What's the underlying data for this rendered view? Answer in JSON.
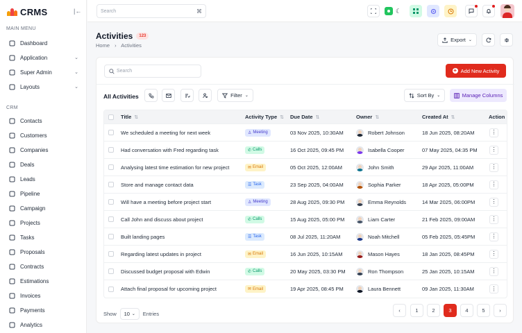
{
  "app": {
    "name": "CRMS"
  },
  "sidebar": {
    "section_main": "MAIN MENU",
    "section_crm": "CRM",
    "main_items": [
      {
        "label": "Dashboard",
        "icon": "dashboard-icon",
        "has_chevron": false
      },
      {
        "label": "Application",
        "icon": "application-icon",
        "has_chevron": true
      },
      {
        "label": "Super Admin",
        "icon": "user-shield-icon",
        "has_chevron": true
      },
      {
        "label": "Layouts",
        "icon": "layout-icon",
        "has_chevron": true
      }
    ],
    "crm_items": [
      {
        "label": "Contacts",
        "icon": "contacts-icon"
      },
      {
        "label": "Customers",
        "icon": "customers-icon"
      },
      {
        "label": "Companies",
        "icon": "building-icon"
      },
      {
        "label": "Deals",
        "icon": "deals-icon"
      },
      {
        "label": "Leads",
        "icon": "leads-icon"
      },
      {
        "label": "Pipeline",
        "icon": "pipeline-icon"
      },
      {
        "label": "Campaign",
        "icon": "campaign-icon"
      },
      {
        "label": "Projects",
        "icon": "projects-icon"
      },
      {
        "label": "Tasks",
        "icon": "tasks-icon"
      },
      {
        "label": "Proposals",
        "icon": "proposals-icon"
      },
      {
        "label": "Contracts",
        "icon": "contracts-icon"
      },
      {
        "label": "Estimations",
        "icon": "estimations-icon"
      },
      {
        "label": "Invoices",
        "icon": "invoices-icon"
      },
      {
        "label": "Payments",
        "icon": "payments-icon"
      },
      {
        "label": "Analytics",
        "icon": "analytics-icon"
      }
    ]
  },
  "topbar": {
    "search_placeholder": "Search",
    "shortcut": "⌘"
  },
  "page": {
    "title": "Activities",
    "count": "123",
    "breadcrumb_home": "Home",
    "breadcrumb_current": "Activities",
    "export_label": "Export"
  },
  "card": {
    "search_placeholder": "Search",
    "add_button": "Add New Activity",
    "all_label": "All Activities",
    "filter_label": "Filter",
    "sort_label": "Sort By",
    "manage_columns": "Manage Columns"
  },
  "table": {
    "headers": [
      "Title",
      "Activity Type",
      "Due Date",
      "Owner",
      "Created At",
      "Action"
    ],
    "rows": [
      {
        "title": "We scheduled a meeting for next week",
        "type": "Meeting",
        "due": "03 Nov 2025, 10:30AM",
        "owner": "Robert Johnson",
        "created": "18 Jun 2025, 08:20AM"
      },
      {
        "title": "Had conversation with Fred regarding task",
        "type": "Calls",
        "due": "16 Oct 2025, 09:45 PM",
        "owner": "Isabella Cooper",
        "created": "07 May 2025, 04:35 PM"
      },
      {
        "title": "Analysing latest time estimation for new project",
        "type": "Email",
        "due": "05 Oct 2025, 12:00AM",
        "owner": "John Smith",
        "created": "29 Apr 2025, 11:00AM"
      },
      {
        "title": "Store and manage contact data",
        "type": "Task",
        "due": "23 Sep 2025, 04:00AM",
        "owner": "Sophia Parker",
        "created": "18 Apr 2025, 05:00PM"
      },
      {
        "title": "Will have a meeting before project start",
        "type": "Meeting",
        "due": "28 Aug 2025, 09:30 PM",
        "owner": "Emma Reynolds",
        "created": "14 Mar 2025, 06:00PM"
      },
      {
        "title": "Call John and discuss about project",
        "type": "Calls",
        "due": "15 Aug 2025, 05:00 PM",
        "owner": "Liam Carter",
        "created": "21 Feb 2025, 09:00AM"
      },
      {
        "title": "Built landing pages",
        "type": "Task",
        "due": "08 Jul 2025, 11:20AM",
        "owner": "Noah Mitchell",
        "created": "05 Feb 2025, 05:45PM"
      },
      {
        "title": "Regarding latest updates in project",
        "type": "Email",
        "due": "16 Jun 2025, 10:15AM",
        "owner": "Mason Hayes",
        "created": "18 Jan 2025, 08:45PM"
      },
      {
        "title": "Discussed budget proposal with Edwin",
        "type": "Calls",
        "due": "20 May 2025, 03:30 PM",
        "owner": "Ron Thompson",
        "created": "25 Jan 2025, 10:15AM"
      },
      {
        "title": "Attach final proposal for upcoming project",
        "type": "Email",
        "due": "19 Apr 2025, 08:45 PM",
        "owner": "Laura Bennett",
        "created": "09 Jan 2025, 11:30AM"
      }
    ]
  },
  "type_styles": {
    "Meeting": {
      "bg": "#e0e7ff",
      "fg": "#4338ca",
      "icon": "users-icon"
    },
    "Calls": {
      "bg": "#d1fae5",
      "fg": "#059669",
      "icon": "phone-icon"
    },
    "Email": {
      "bg": "#fef3c7",
      "fg": "#d97706",
      "icon": "mail-icon"
    },
    "Task": {
      "bg": "#dbeafe",
      "fg": "#2563eb",
      "icon": "task-icon"
    }
  },
  "footer": {
    "show_label": "Show",
    "entries_value": "10",
    "entries_label": "Entries",
    "pages": [
      "1",
      "2",
      "3",
      "4",
      "5"
    ],
    "active_page": "3"
  },
  "colors": {
    "accent": "#e02b1d",
    "purple": "#5b21b6"
  }
}
